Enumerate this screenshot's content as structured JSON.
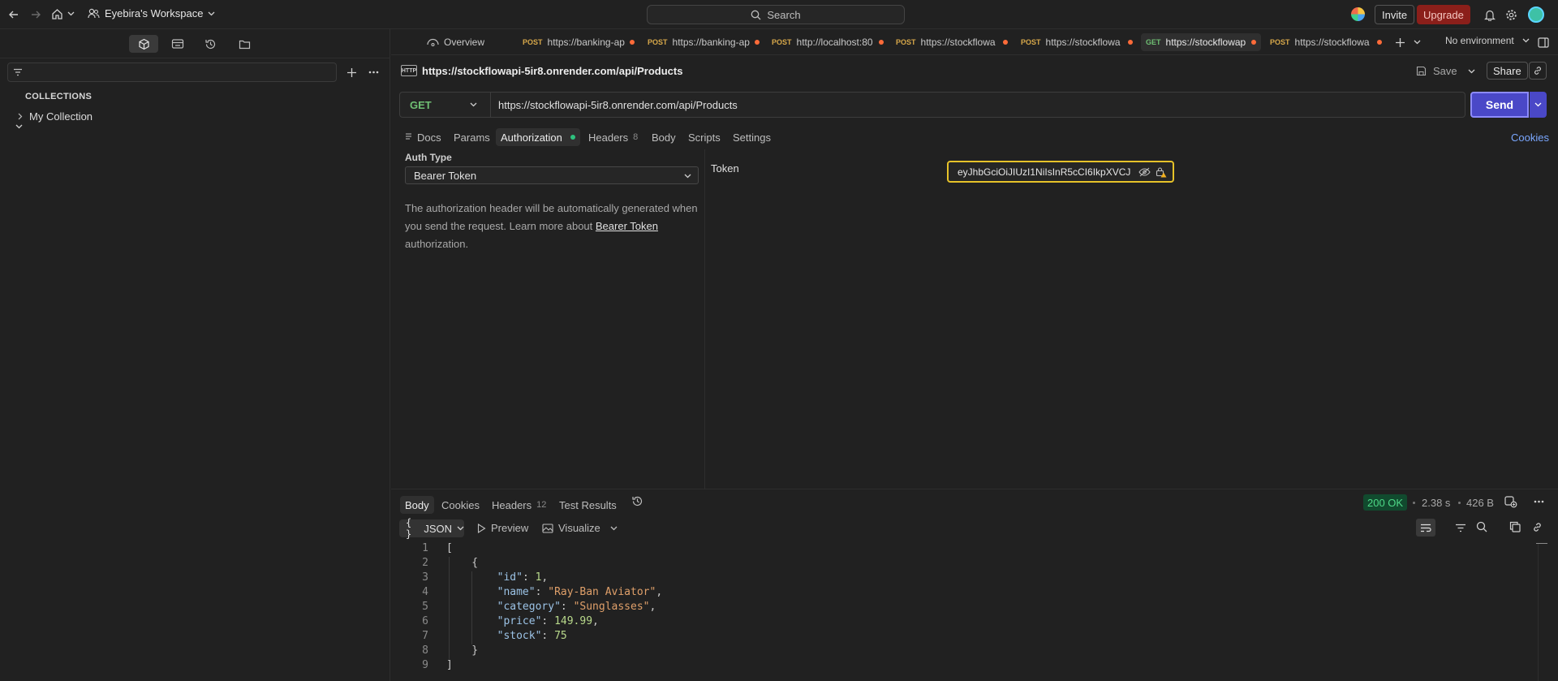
{
  "topbar": {
    "workspace_name": "Eyebira's Workspace",
    "search_label": "Search",
    "invite_label": "Invite",
    "upgrade_label": "Upgrade"
  },
  "sidebar": {
    "collections_heading": "COLLECTIONS",
    "collections": [
      {
        "label": "My Collection"
      }
    ]
  },
  "tabs": {
    "overview_label": "Overview",
    "items": [
      {
        "method": "POST",
        "url": "https://banking-ap"
      },
      {
        "method": "POST",
        "url": "https://banking-ap"
      },
      {
        "method": "POST",
        "url": "http://localhost:80"
      },
      {
        "method": "POST",
        "url": "https://stockflowa"
      },
      {
        "method": "POST",
        "url": "https://stockflowa"
      },
      {
        "method": "GET",
        "url": "https://stockflowap"
      },
      {
        "method": "POST",
        "url": "https://stockflowa"
      }
    ],
    "environment": "No environment"
  },
  "request": {
    "title": "https://stockflowapi-5ir8.onrender.com/api/Products",
    "http_badge": "HTTP",
    "save_label": "Save",
    "share_label": "Share",
    "method": "GET",
    "url": "https://stockflowapi-5ir8.onrender.com/api/Products",
    "send_label": "Send",
    "sub_tabs": {
      "docs": "Docs",
      "params": "Params",
      "authorization": "Authorization",
      "headers": "Headers",
      "headers_count": "8",
      "body": "Body",
      "scripts": "Scripts",
      "settings": "Settings",
      "cookies": "Cookies"
    }
  },
  "auth": {
    "auth_type_label": "Auth Type",
    "auth_type_value": "Bearer Token",
    "description_before": "The authorization header will be automatically generated when you send the request. Learn more about ",
    "description_link": "Bearer Token",
    "description_after": " authorization.",
    "token_label": "Token",
    "token_value": "eyJhbGciOiJIUzI1NiIsInR5cCI6IkpXVCJ"
  },
  "response": {
    "tabs": {
      "body": "Body",
      "cookies": "Cookies",
      "headers": "Headers",
      "headers_count": "12",
      "test_results": "Test Results"
    },
    "status": "200 OK",
    "time": "2.38 s",
    "size": "426 B",
    "format": "JSON",
    "preview_label": "Preview",
    "visualize_label": "Visualize",
    "line_numbers": [
      "1",
      "2",
      "3",
      "4",
      "5",
      "6",
      "7",
      "8",
      "9"
    ],
    "json": {
      "id_key": "\"id\"",
      "id_val": "1",
      "name_key": "\"name\"",
      "name_val": "\"Ray-Ban Aviator\"",
      "category_key": "\"category\"",
      "category_val": "\"Sunglasses\"",
      "price_key": "\"price\"",
      "price_val": "149.99",
      "stock_key": "\"stock\"",
      "stock_val": "75"
    }
  },
  "colors": {
    "accent": "#4a48c7",
    "upgrade": "#8b1f1a",
    "get_method": "#6fbf73",
    "post_method": "#d7a84a",
    "status_ok": "#4ed987",
    "unsaved_dot": "#ff6b39"
  }
}
